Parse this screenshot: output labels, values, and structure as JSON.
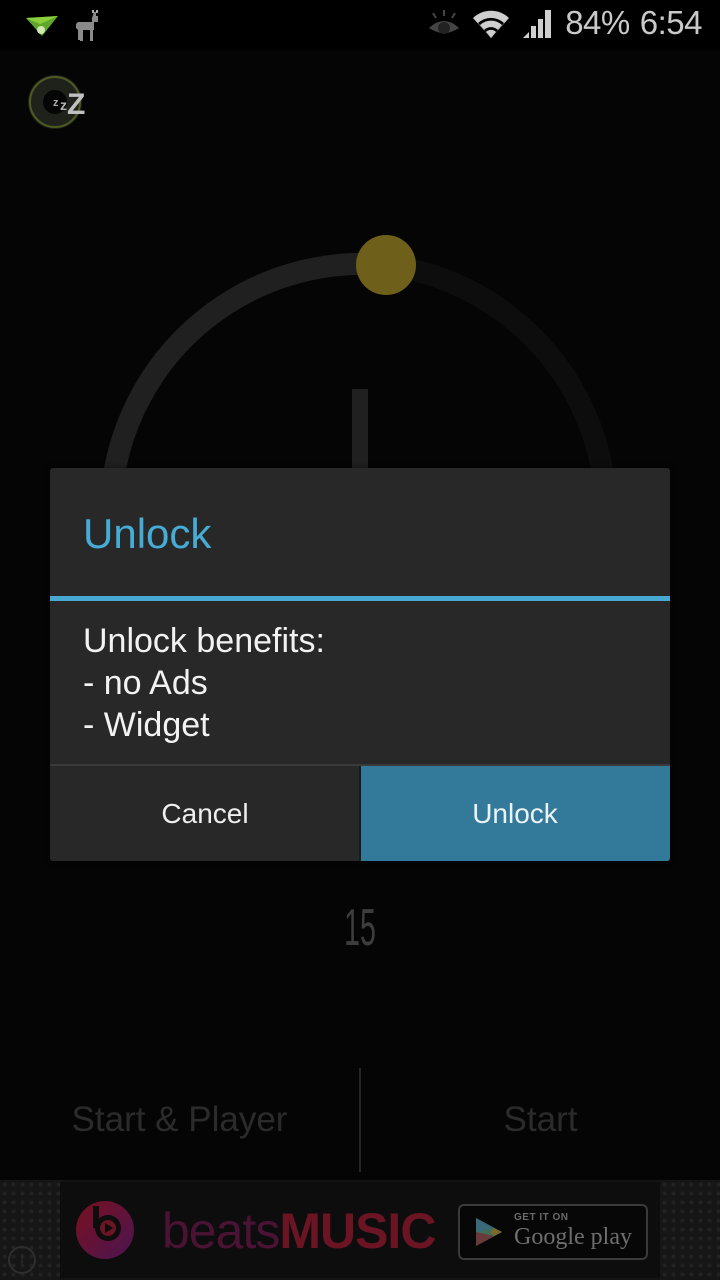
{
  "status_bar": {
    "notification_icons": [
      "airdroid-paper-plane-icon",
      "llama-icon"
    ],
    "system_icons": [
      "smart-stay-eye-icon",
      "wifi-icon",
      "signal-icon"
    ],
    "battery": "84%",
    "time": "6:54"
  },
  "app": {
    "icon": "sleep-timer-zz-icon"
  },
  "dial": {
    "knob_color": "#6e5f1a",
    "track_color": "#202020",
    "progress_fraction": 0.25
  },
  "timer": {
    "value": "15"
  },
  "dialog": {
    "title": "Unlock",
    "accent_color": "#48a9d3",
    "body_lines": [
      "Unlock benefits:",
      "- no Ads",
      "- Widget"
    ],
    "cancel_label": "Cancel",
    "confirm_label": "Unlock",
    "confirm_color": "#33799a"
  },
  "bottom_actions": {
    "start_player_label": "Start & Player",
    "start_label": "Start"
  },
  "ad": {
    "brand_light": "beats",
    "brand_bold": "MUSIC",
    "store_small": "GET IT ON",
    "store_big": "Google play",
    "info_glyph": "i"
  }
}
